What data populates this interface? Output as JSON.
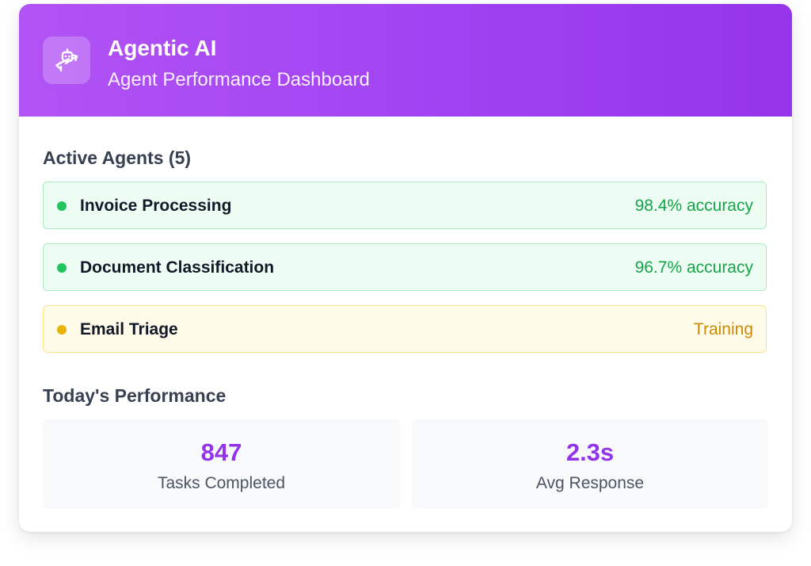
{
  "header": {
    "title": "Agentic AI",
    "subtitle": "Agent Performance Dashboard",
    "icon": "robot-arrows-icon",
    "gradient_start": "#b253f5",
    "gradient_end": "#9534ea"
  },
  "agents": {
    "section_title": "Active Agents (5)",
    "items": [
      {
        "name": "Invoice Processing",
        "status": "98.4% accuracy",
        "state": "active",
        "status_color": "#16a34a",
        "dot_color": "#22c55e"
      },
      {
        "name": "Document Classification",
        "status": "96.7% accuracy",
        "state": "active",
        "status_color": "#16a34a",
        "dot_color": "#22c55e"
      },
      {
        "name": "Email Triage",
        "status": "Training",
        "state": "training",
        "status_color": "#ca8a04",
        "dot_color": "#eab308"
      }
    ]
  },
  "performance": {
    "section_title": "Today's Performance",
    "stats": [
      {
        "value": "847",
        "label": "Tasks Completed"
      },
      {
        "value": "2.3s",
        "label": "Avg Response"
      }
    ],
    "value_color": "#9333ea"
  }
}
